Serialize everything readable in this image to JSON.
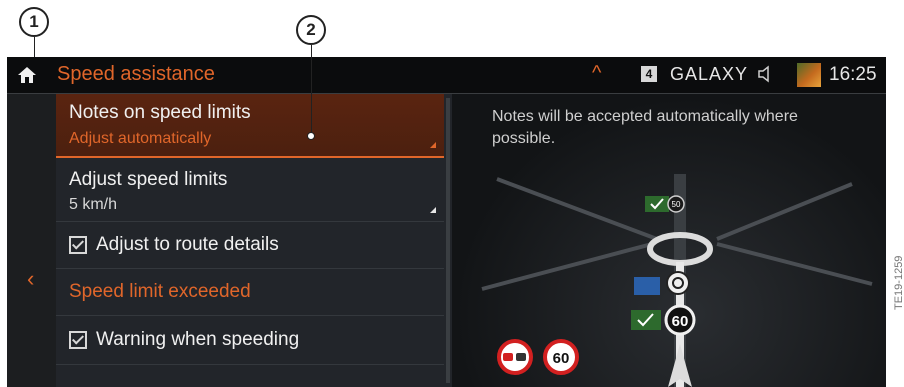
{
  "callouts": {
    "one": "1",
    "two": "2"
  },
  "header": {
    "title": "Speed assistance",
    "radio_preset": "4",
    "radio_name": "GALAXY",
    "time": "16:25"
  },
  "menu": {
    "items": [
      {
        "label": "Notes on speed limits",
        "value": "Adjust automatically",
        "selected": true
      },
      {
        "label": "Adjust speed limits",
        "value": "5 km/h"
      },
      {
        "label": "Adjust to route details",
        "checked": true
      },
      {
        "label": "Speed limit exceeded",
        "section_heading": true
      },
      {
        "label": "Warning when speeding",
        "checked": true
      }
    ]
  },
  "info": {
    "text": "Notes will be accepted automatically where possible.",
    "sign_small": "50",
    "sign_large": "60",
    "sign_bottom": "60"
  },
  "icons": [
    "home-icon",
    "chevron-up-icon",
    "speaker-icon",
    "back-chevron-icon",
    "checkbox-icon",
    "no-overtaking-icon",
    "speed-limit-sign-icon",
    "navigation-arrow-icon"
  ],
  "colors": {
    "accent": "#e0662a",
    "background": "#141618",
    "text": "#f0f0f0"
  },
  "watermark": "TE19-1259"
}
